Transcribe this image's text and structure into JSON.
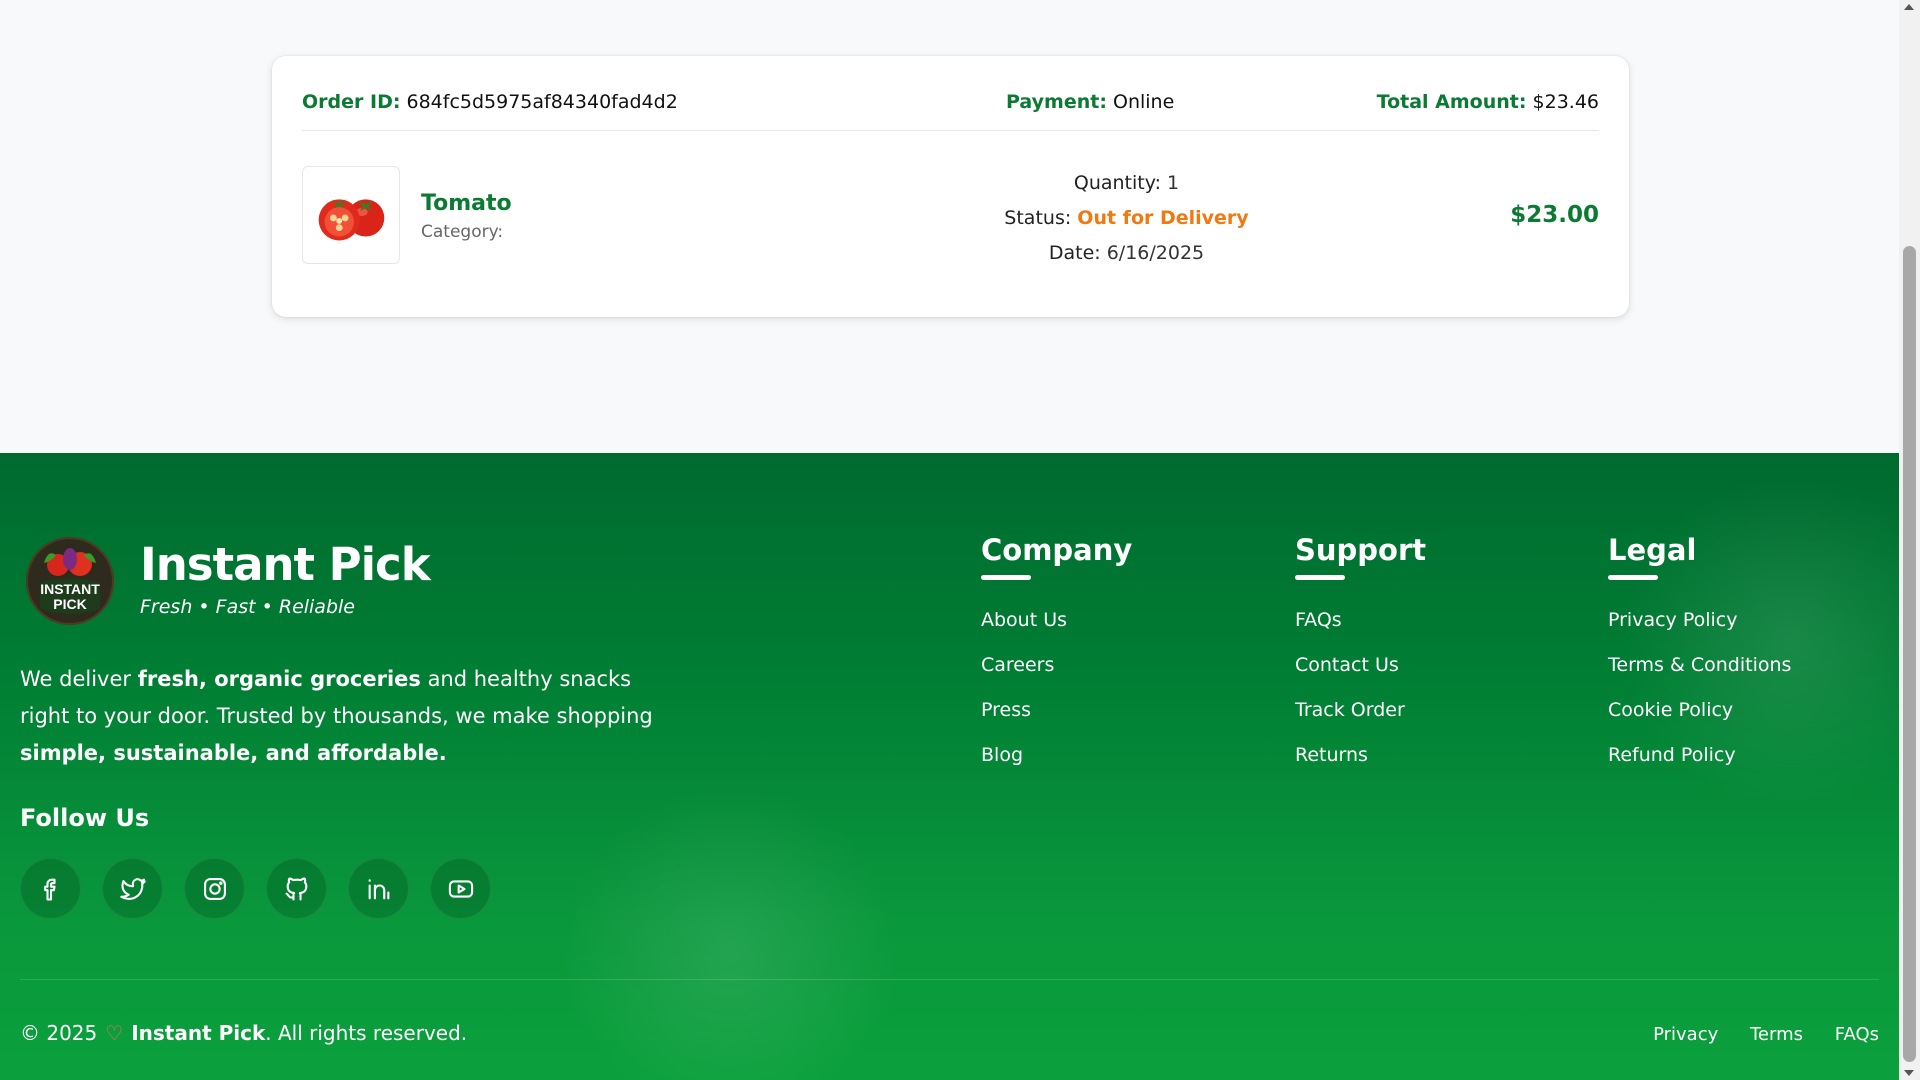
{
  "order": {
    "id_label": "Order ID:",
    "id": "684fc5d5975af84340fad4d2",
    "payment_label": "Payment:",
    "payment": "Online",
    "total_label": "Total Amount:",
    "total": "$23.46",
    "item": {
      "name": "Tomato",
      "category_label": "Category:",
      "category": "",
      "quantity_label": "Quantity:",
      "quantity": "1",
      "status_label": "Status:",
      "status": "Out for Delivery",
      "date_label": "Date:",
      "date": "6/16/2025",
      "price": "$23.00",
      "image_icon": "tomato-image"
    }
  },
  "footer": {
    "brand_name": "Instant Pick",
    "tagline": "Fresh • Fast • Reliable",
    "logo_text_1": "INSTANT",
    "logo_text_2": "PICK",
    "desc_1": "We deliver ",
    "desc_bold_1": "fresh, organic groceries",
    "desc_2": " and healthy snacks right to your door. Trusted by thousands, we make shopping ",
    "desc_bold_2": "simple, sustainable, and affordable.",
    "follow_title": "Follow Us",
    "socials": [
      "facebook-icon",
      "twitter-icon",
      "instagram-icon",
      "github-icon",
      "linkedin-icon",
      "youtube-icon"
    ],
    "columns": [
      {
        "title": "Company",
        "links": [
          "About Us",
          "Careers",
          "Press",
          "Blog"
        ]
      },
      {
        "title": "Support",
        "links": [
          "FAQs",
          "Contact Us",
          "Track Order",
          "Returns"
        ]
      },
      {
        "title": "Legal",
        "links": [
          "Privacy Policy",
          "Terms & Conditions",
          "Cookie Policy",
          "Refund Policy"
        ]
      }
    ],
    "copyright_prefix": "© 2025",
    "copyright_brand": "Instant Pick",
    "copyright_suffix": ". All rights reserved.",
    "bottom_links": [
      "Privacy",
      "Terms",
      "FAQs"
    ]
  },
  "colors": {
    "accent_green": "#0b7a32",
    "status_orange": "#f07a11",
    "footer_green": "#007e34"
  }
}
